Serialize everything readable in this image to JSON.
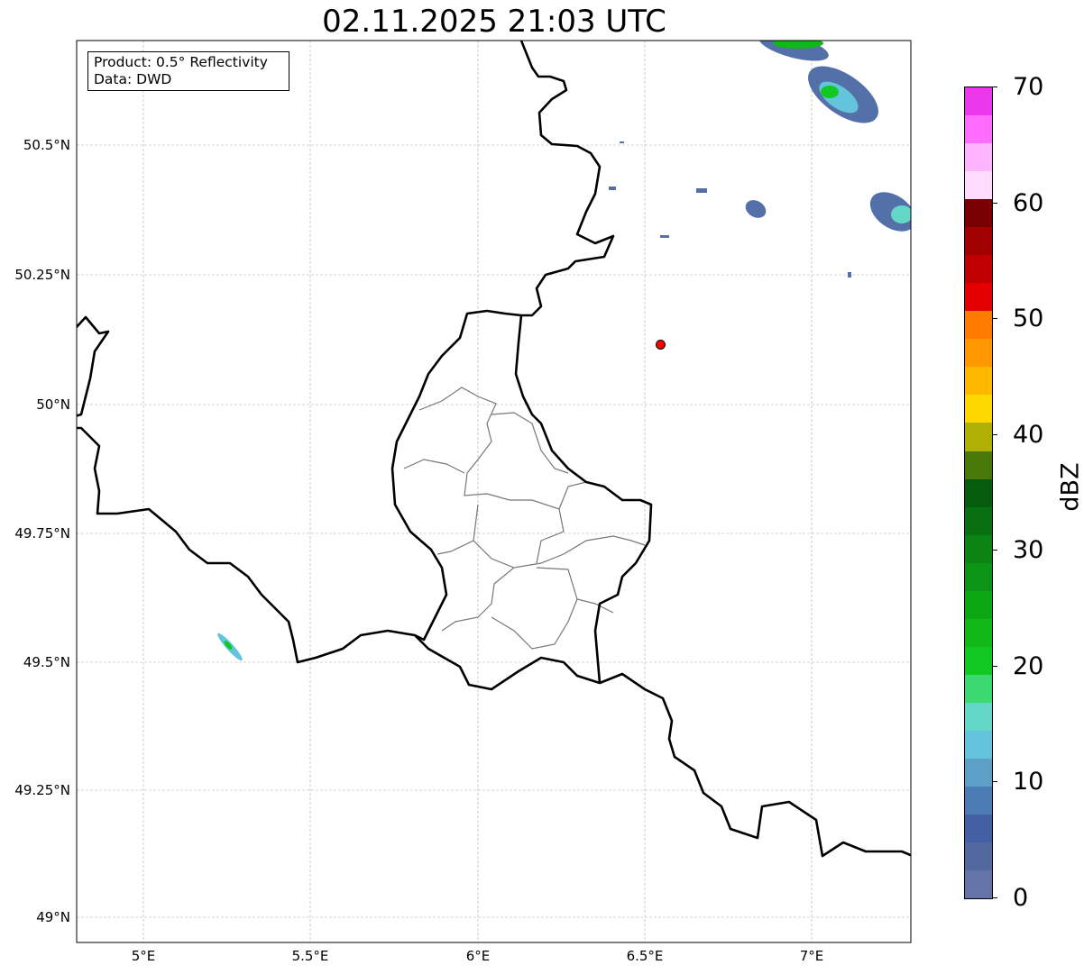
{
  "title": "02.11.2025 21:03 UTC",
  "info": {
    "product": "Product: 0.5° Reflectivity",
    "data": "Data: DWD"
  },
  "axes": {
    "lat_ticks": [
      "50.5°N",
      "50.25°N",
      "50°N",
      "49.75°N",
      "49.5°N",
      "49.25°N",
      "49°N"
    ],
    "lon_ticks": [
      "5°E",
      "5.5°E",
      "6°E",
      "6.5°E",
      "7°E"
    ],
    "lon_range": [
      4.8,
      7.3
    ],
    "lat_range": [
      48.95,
      50.7
    ],
    "grid": true
  },
  "marker": {
    "name": "site-marker",
    "lon": 6.55,
    "lat": 50.11,
    "color": "#ff0000"
  },
  "colorbar": {
    "label": "dBZ",
    "min": 0,
    "max": 70,
    "step": 2.5,
    "ticks": [
      "0",
      "10",
      "20",
      "30",
      "40",
      "50",
      "60",
      "70"
    ],
    "colors": [
      "#6474a8",
      "#5468a0",
      "#4460a4",
      "#4c7cb4",
      "#5ca0c8",
      "#64c4dc",
      "#64d8c8",
      "#3cd870",
      "#10c820",
      "#10b818",
      "#0ca814",
      "#0c9414",
      "#0c8414",
      "#087010",
      "#045c0c",
      "#487808",
      "#b0b004",
      "#ffd800",
      "#ffb800",
      "#ff9800",
      "#ff7c00",
      "#e40000",
      "#c00000",
      "#a00000",
      "#780000",
      "#ffdcff",
      "#ffb4ff",
      "#ff6cff",
      "#ec38ec"
    ]
  }
}
